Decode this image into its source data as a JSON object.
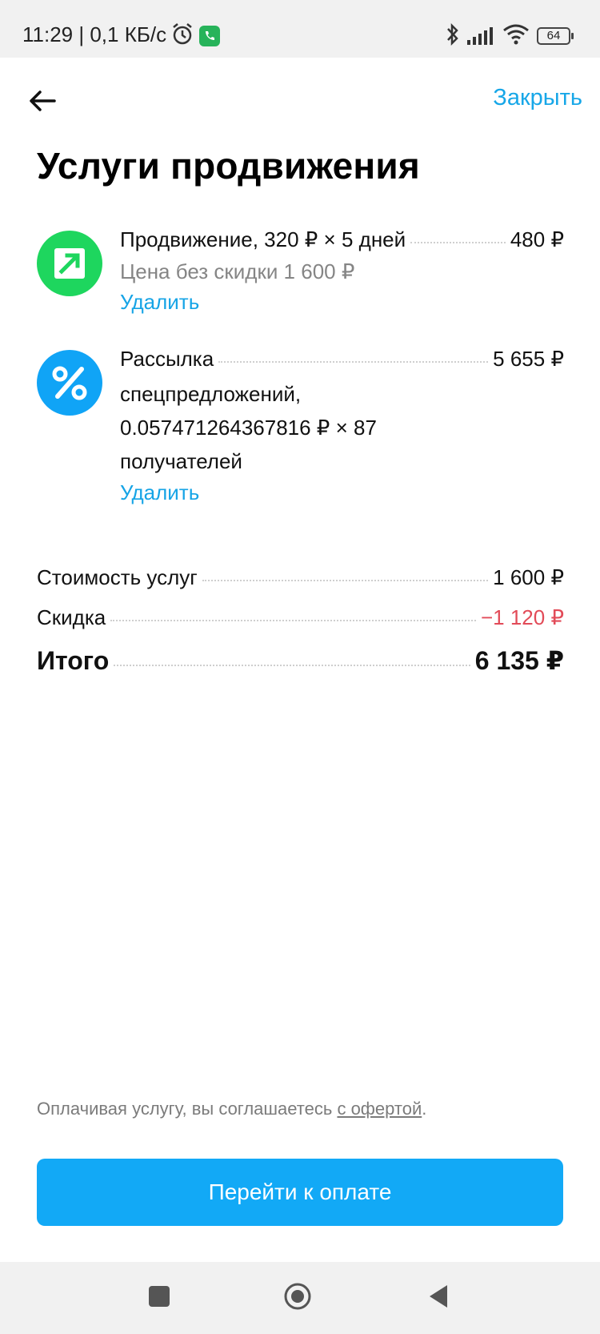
{
  "status_bar": {
    "time": "11:29 | 0,1 КБ/с",
    "battery": "64"
  },
  "header": {
    "close_label": "Закрыть",
    "title": "Услуги продвижения"
  },
  "services": [
    {
      "icon": "arrow-up-right-icon",
      "name": "Продвижение, 320 ₽ × 5 дней",
      "price": "480 ₽",
      "subtitle": "Цена без скидки 1 600 ₽",
      "delete_label": "Удалить"
    },
    {
      "icon": "percent-icon",
      "name": "Рассылка",
      "name_line2": "спецпредложений,",
      "name_line3": "0.057471264367816 ₽ × 87",
      "name_line4": "получателей",
      "price": "5 655 ₽",
      "delete_label": "Удалить"
    }
  ],
  "summary": {
    "cost_label": "Стоимость услуг",
    "cost_value": "1 600 ₽",
    "discount_label": "Скидка",
    "discount_value": "−1 120 ₽",
    "total_label": "Итого",
    "total_value": "6 135 ₽"
  },
  "footer": {
    "offer_text": "Оплачивая услугу, вы соглашаетесь ",
    "offer_link": "с офертой",
    "offer_end": ".",
    "pay_button": "Перейти к оплате"
  },
  "colors": {
    "accent": "#12a9f6",
    "link": "#17a7e8",
    "promo_icon": "#1ed65e",
    "discount": "#e24b58"
  }
}
